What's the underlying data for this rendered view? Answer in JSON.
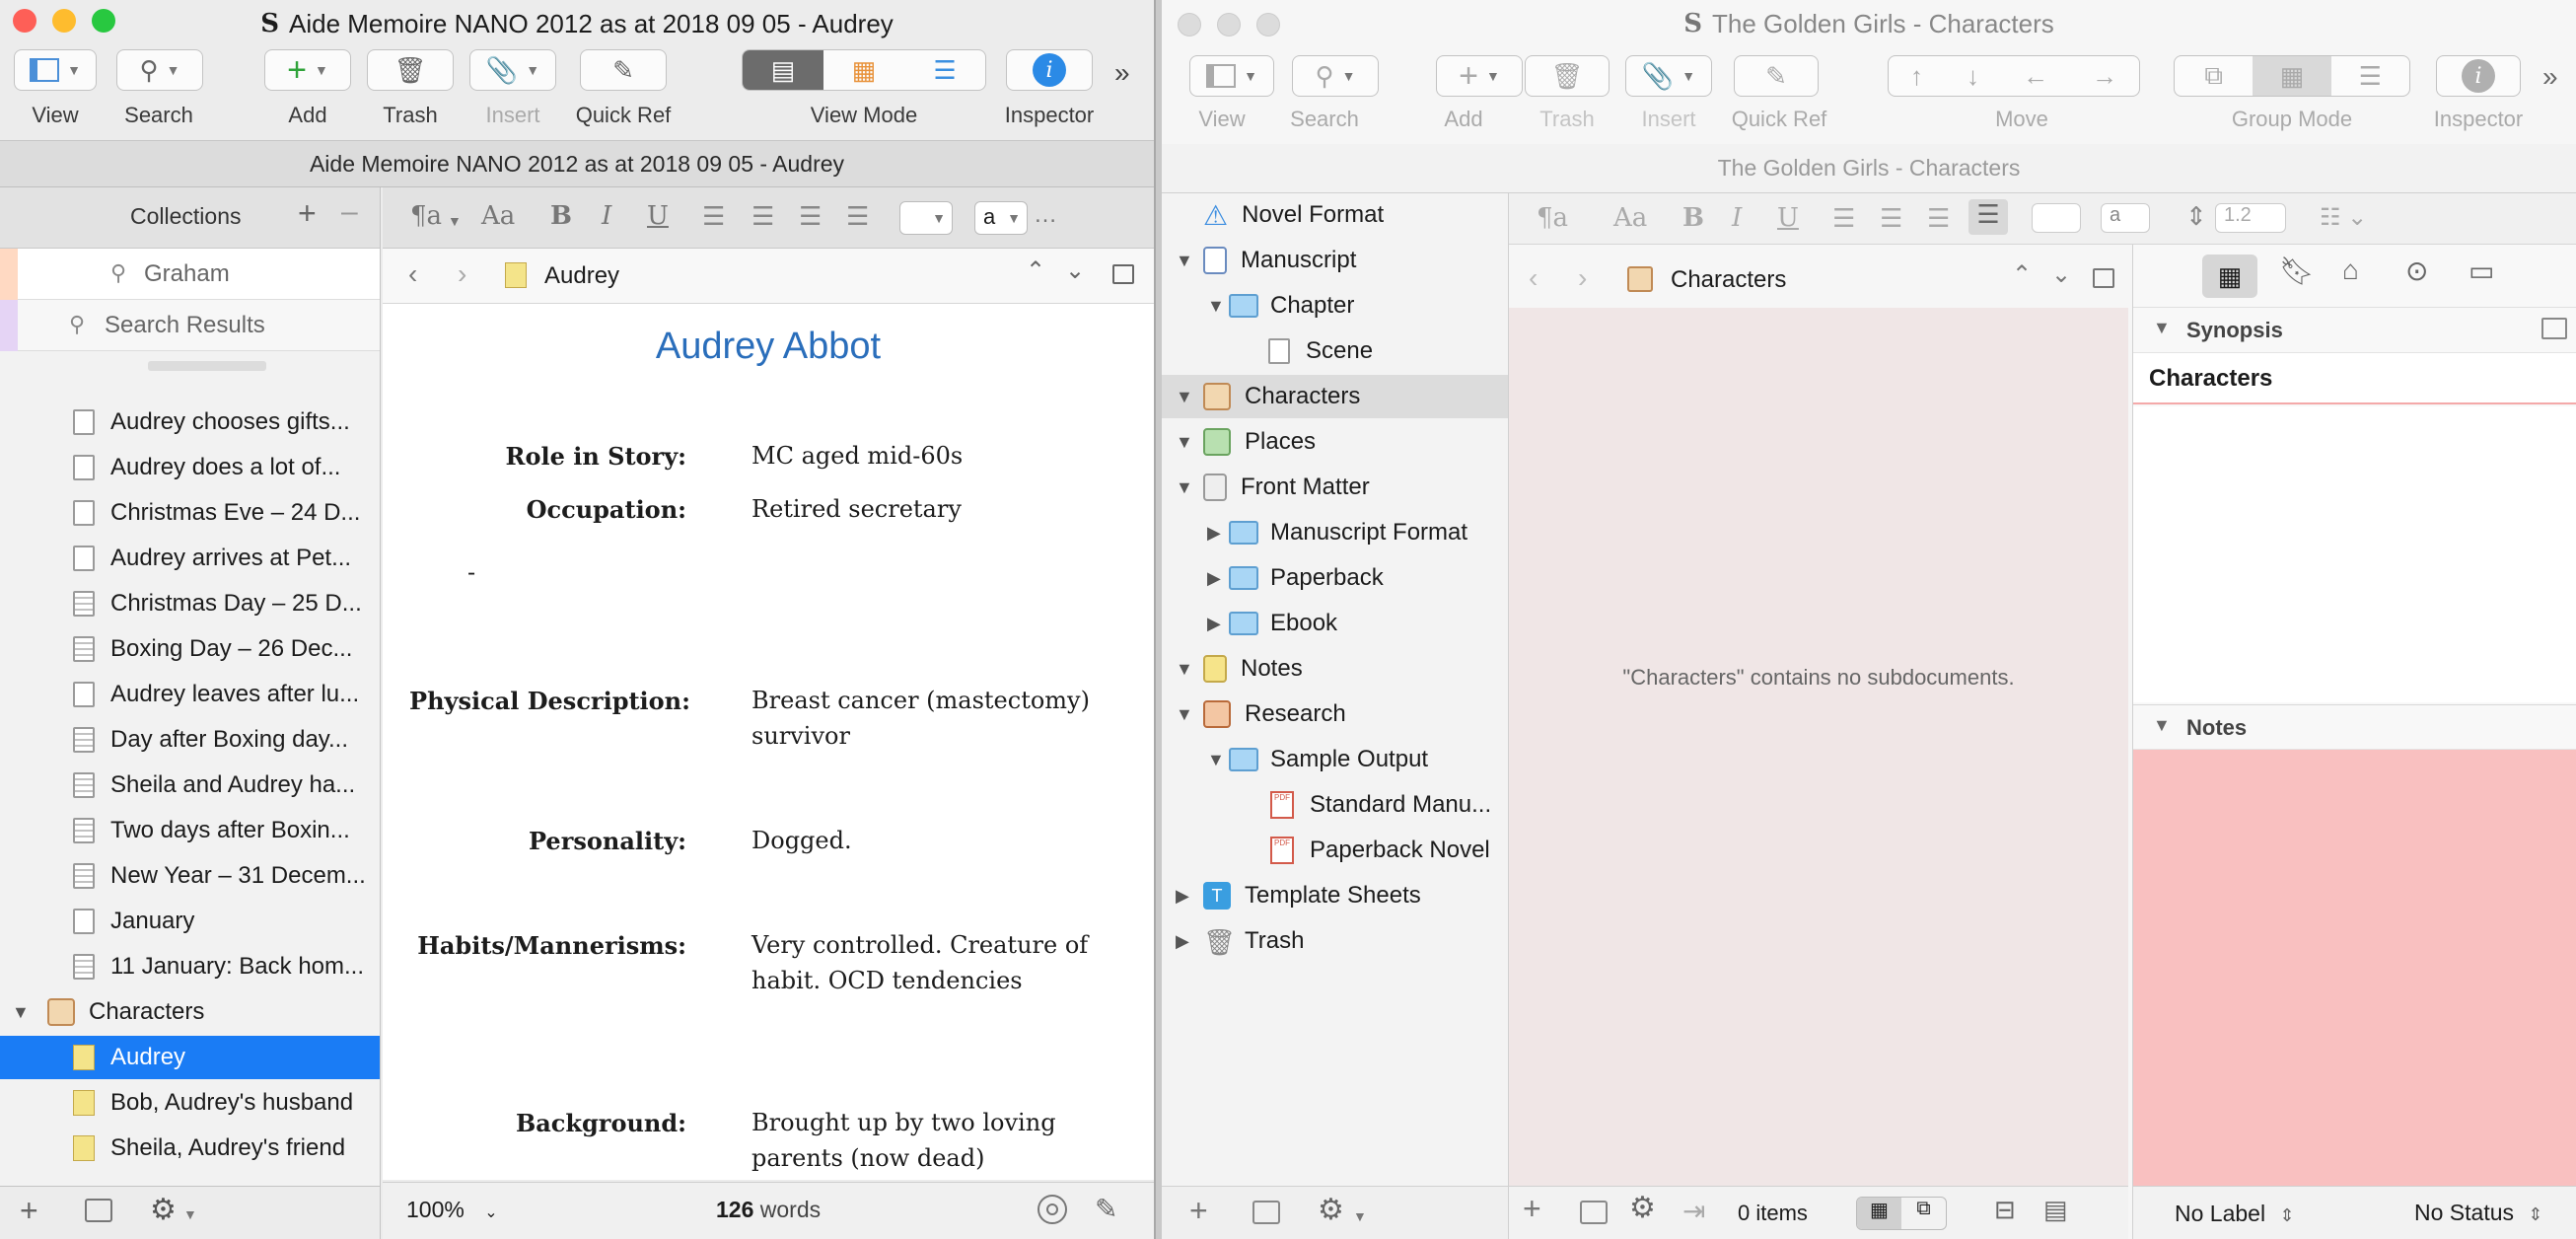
{
  "left": {
    "title": "Aide Memoire NANO 2012 as at 2018 09 05 - Audrey",
    "toolbar": {
      "view": "View",
      "search": "Search",
      "add": "Add",
      "trash": "Trash",
      "insert": "Insert",
      "quickref": "Quick Ref",
      "viewmode": "View Mode",
      "inspector": "Inspector"
    },
    "subtitle": "Aide Memoire NANO 2012 as at 2018 09 05 - Audrey",
    "collections": {
      "label": "Collections",
      "search_tab": "Graham",
      "results_tab": "Search Results"
    },
    "binder": [
      {
        "label": "Audrey chooses gifts..."
      },
      {
        "label": "Audrey does a lot of..."
      },
      {
        "label": "Christmas Eve – 24 D..."
      },
      {
        "label": "Audrey arrives at Pet..."
      },
      {
        "label": "Christmas Day – 25 D..."
      },
      {
        "label": "Boxing Day – 26 Dec..."
      },
      {
        "label": "Audrey leaves after lu..."
      },
      {
        "label": "Day after Boxing day..."
      },
      {
        "label": "Sheila and Audrey ha..."
      },
      {
        "label": "Two days after Boxin..."
      },
      {
        "label": "New Year – 31 Decem..."
      },
      {
        "label": "January"
      },
      {
        "label": "11 January: Back hom..."
      },
      {
        "label": "Characters"
      },
      {
        "label": "Audrey"
      },
      {
        "label": "Bob, Audrey's husband"
      },
      {
        "label": "Sheila, Audrey's friend"
      }
    ],
    "format": {
      "para": "¶a",
      "font": "Aa",
      "bold": "B",
      "italic": "I",
      "underline": "U",
      "style": "a"
    },
    "editor": {
      "header_title": "Audrey",
      "doc_title": "Audrey Abbot",
      "dash": "-",
      "fields": [
        {
          "label": "Role in Story:",
          "value": "MC aged mid-60s"
        },
        {
          "label": "Occupation:",
          "value": "Retired secretary"
        },
        {
          "label": "Physical Description:",
          "value": "Breast cancer (mastectomy)",
          "value2": "survivor"
        },
        {
          "label": "Personality:",
          "value": "Dogged."
        },
        {
          "label": "Habits/Mannerisms:",
          "value": "Very controlled. Creature of",
          "value2": "habit. OCD tendencies"
        },
        {
          "label": "Background:",
          "value": "Brought up by two loving",
          "value2": "parents (now dead)"
        }
      ],
      "zoom": "100%",
      "word_count": "126",
      "words_label": "words"
    }
  },
  "right": {
    "title": "The Golden Girls - Characters",
    "toolbar": {
      "view": "View",
      "search": "Search",
      "add": "Add",
      "trash": "Trash",
      "insert": "Insert",
      "quickref": "Quick Ref",
      "move": "Move",
      "groupmode": "Group Mode",
      "inspector": "Inspector"
    },
    "subtitle": "The Golden Girls - Characters",
    "binder": [
      {
        "label": "Novel Format"
      },
      {
        "label": "Manuscript"
      },
      {
        "label": "Chapter"
      },
      {
        "label": "Scene"
      },
      {
        "label": "Characters"
      },
      {
        "label": "Places"
      },
      {
        "label": "Front Matter"
      },
      {
        "label": "Manuscript Format"
      },
      {
        "label": "Paperback"
      },
      {
        "label": "Ebook"
      },
      {
        "label": "Notes"
      },
      {
        "label": "Research"
      },
      {
        "label": "Sample Output"
      },
      {
        "label": "Standard Manu..."
      },
      {
        "label": "Paperback Novel"
      },
      {
        "label": "Template Sheets"
      },
      {
        "label": "Trash"
      }
    ],
    "format": {
      "para": "¶a",
      "font": "Aa",
      "bold": "B",
      "italic": "I",
      "underline": "U",
      "style": "a",
      "line_spacing": "1.2"
    },
    "editor": {
      "header_title": "Characters",
      "empty_message": "\"Characters\" contains no subdocuments.",
      "items": "0 items"
    },
    "inspector": {
      "synopsis_label": "Synopsis",
      "synopsis_title": "Characters",
      "notes_label": "Notes",
      "label_select": "No Label",
      "status_select": "No Status"
    }
  },
  "colors": {
    "selection": "#1a7cf5",
    "notes_bg": "#f9c0c0",
    "synopsis_rule": "#f4a9a9",
    "link_title": "#2a6ebb",
    "empty_bg": "#f0e6e6"
  }
}
